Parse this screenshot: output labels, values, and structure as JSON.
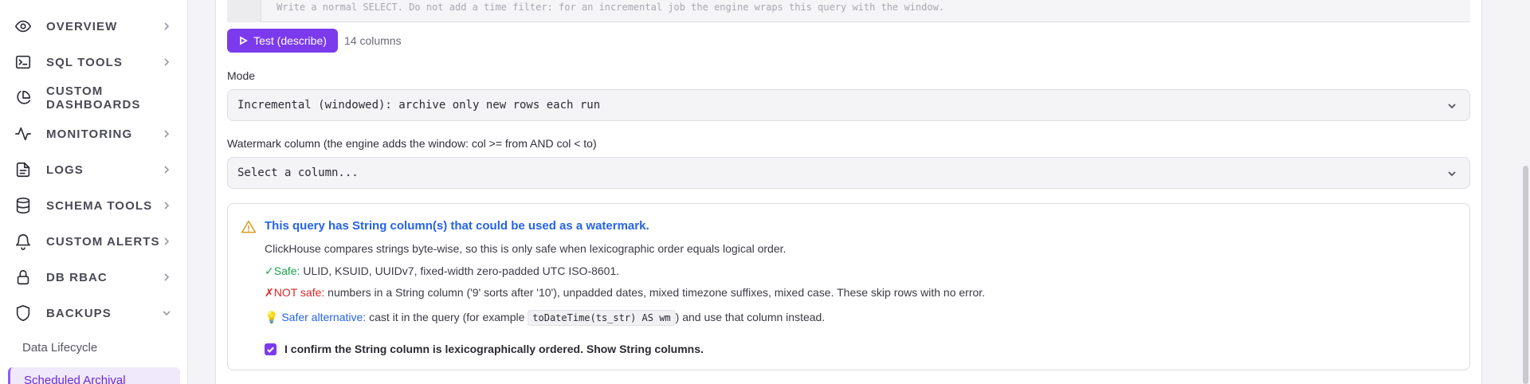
{
  "sidebar": {
    "items": [
      {
        "label": "OVERVIEW",
        "icon": "eye-icon",
        "expanded": false
      },
      {
        "label": "SQL TOOLS",
        "icon": "terminal-icon",
        "expanded": false
      },
      {
        "label": "CUSTOM DASHBOARDS",
        "icon": "pie-chart-icon",
        "expanded": false
      },
      {
        "label": "MONITORING",
        "icon": "activity-icon",
        "expanded": false
      },
      {
        "label": "LOGS",
        "icon": "file-text-icon",
        "expanded": false
      },
      {
        "label": "SCHEMA TOOLS",
        "icon": "database-icon",
        "expanded": false
      },
      {
        "label": "CUSTOM ALERTS",
        "icon": "bell-icon",
        "expanded": false
      },
      {
        "label": "DB RBAC",
        "icon": "lock-icon",
        "expanded": false
      },
      {
        "label": "BACKUPS",
        "icon": "shield-icon",
        "expanded": true
      }
    ],
    "subitems": [
      {
        "label": "Data Lifecycle",
        "active": false
      },
      {
        "label": "Scheduled Archival",
        "active": true
      }
    ]
  },
  "editor": {
    "hint": "Write a normal SELECT. Do not add a time filter: for an incremental job the engine wraps this query with the window."
  },
  "test": {
    "button_label": "Test (describe)",
    "columns_text": "14 columns"
  },
  "mode": {
    "label": "Mode",
    "value": "Incremental (windowed): archive only new rows each run"
  },
  "watermark": {
    "label": "Watermark column (the engine adds the window: col >= from AND col < to)",
    "placeholder": "Select a column..."
  },
  "warning": {
    "title": "This query has String column(s) that could be used as a watermark.",
    "intro": "ClickHouse compares strings byte-wise, so this is only safe when lexicographic order equals logical order.",
    "safe_mark": "✓",
    "safe_label": "Safe:",
    "safe_text": "ULID, KSUID, UUIDv7, fixed-width zero-padded UTC ISO-8601.",
    "notsafe_mark": "✗",
    "notsafe_label": "NOT safe:",
    "notsafe_text": "numbers in a String column ('9' sorts after '10'), unpadded dates, mixed timezone suffixes, mixed case. These skip rows with no error.",
    "alt_mark": "💡",
    "alt_label": "Safer alternative:",
    "alt_text_before": "cast it in the query (for example",
    "alt_code": "toDateTime(ts_str) AS wm",
    "alt_text_after": ") and use that column instead.",
    "confirm_label": "I confirm the String column is lexicographically ordered. Show String columns.",
    "confirmed": true
  },
  "colors": {
    "accent": "#7c3aed",
    "link_blue": "#2563eb",
    "safe_green": "#16a34a",
    "danger_red": "#dc2626",
    "warn_amber": "#d99a1e"
  }
}
